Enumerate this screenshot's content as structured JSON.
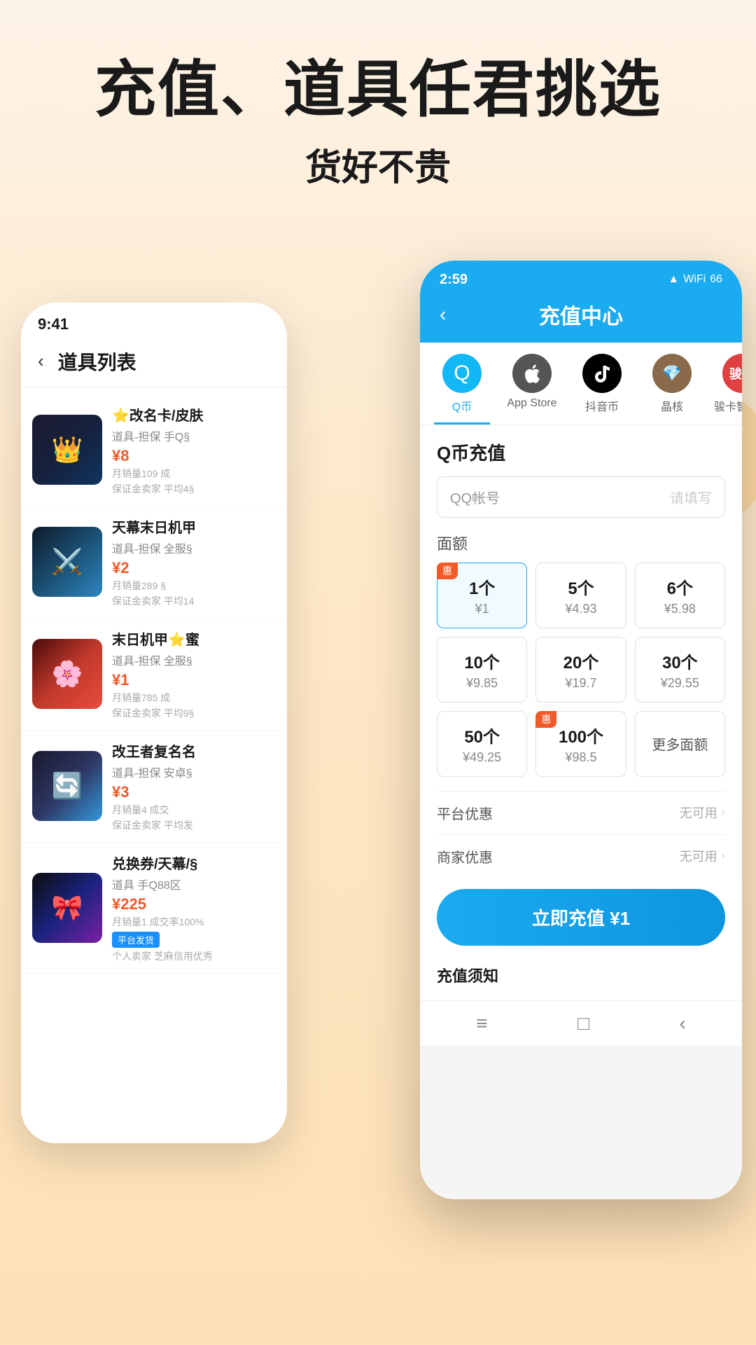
{
  "hero": {
    "title": "充值、道具任君挑选",
    "subtitle": "货好不贵"
  },
  "left_phone": {
    "status_time": "9:41",
    "header_title": "道具列表",
    "items": [
      {
        "name": "⭐改名卡/皮肤",
        "desc": "道具-担保 手Q§",
        "price": "¥8",
        "sales": "月销量109 成",
        "extra": "保证金卖家 平均4§",
        "bg": "bg1",
        "icon": "👑"
      },
      {
        "name": "天幕末日机甲",
        "desc": "道具-担保 全服§",
        "price": "¥2",
        "sales": "月销量289 §",
        "extra": "保证金卖家 平均14",
        "bg": "bg2",
        "icon": "⚔️"
      },
      {
        "name": "末日机甲⭐蜜",
        "desc": "道具-担保 全服§",
        "price": "¥1",
        "sales": "月销量785 成",
        "extra": "保证金卖家 平均9§",
        "bg": "bg3",
        "icon": "🌸"
      },
      {
        "name": "改王者复名名",
        "desc": "道具-担保 安卓§",
        "price": "¥3",
        "sales": "月销量4 成交",
        "extra": "保证金卖家 平均发",
        "bg": "bg4",
        "icon": "🔄"
      },
      {
        "name": "兑换券/天幕/§",
        "desc": "道具 手Q88区",
        "price": "¥225",
        "sales": "月销量1 成交率100%",
        "extra": "平台发货",
        "extra2": "个人卖家 芝麻信用优秀",
        "bg": "bg5",
        "icon": "🎀",
        "badge": "平台发货"
      }
    ]
  },
  "right_phone": {
    "status_time": "2:59",
    "status_icons": "▲ ▲ WiFi 66",
    "nav_title": "充值中心",
    "tabs": [
      {
        "id": "qq",
        "label": "Q币",
        "icon": "Q",
        "active": true
      },
      {
        "id": "appstore",
        "label": "App Store",
        "icon": "",
        "active": false
      },
      {
        "id": "tiktok",
        "label": "抖音币",
        "icon": "♪",
        "active": false
      },
      {
        "id": "crystal",
        "label": "晶核",
        "icon": "🎮",
        "active": false
      },
      {
        "id": "junka",
        "label": "骏卡智充卡",
        "icon": "JUNKA",
        "active": false
      }
    ],
    "section_title": "Q币充值",
    "input_label": "QQ帐号",
    "input_placeholder": "请填写",
    "denomination_title": "面额",
    "denominations": [
      {
        "count": "1个",
        "price": "¥1",
        "selected": true,
        "badge": "惠"
      },
      {
        "count": "5个",
        "price": "¥4.93",
        "selected": false,
        "badge": null
      },
      {
        "count": "6个",
        "price": "¥5.98",
        "selected": false,
        "badge": null
      },
      {
        "count": "10个",
        "price": "¥9.85",
        "selected": false,
        "badge": null
      },
      {
        "count": "20个",
        "price": "¥19.7",
        "selected": false,
        "badge": null
      },
      {
        "count": "30个",
        "price": "¥29.55",
        "selected": false,
        "badge": null
      },
      {
        "count": "50个",
        "price": "¥49.25",
        "selected": false,
        "badge": null
      },
      {
        "count": "100个",
        "price": "¥98.5",
        "selected": false,
        "badge": "惠"
      },
      {
        "count": "更多面额",
        "price": null,
        "selected": false,
        "badge": null,
        "more": true
      }
    ],
    "platform_discount": {
      "label": "平台优惠",
      "value": "无可用"
    },
    "merchant_discount": {
      "label": "商家优惠",
      "value": "无可用"
    },
    "recharge_btn": "立即充值 ¥1",
    "notice_title": "充值须知",
    "bottom_nav": [
      "≡",
      "□",
      "‹"
    ]
  }
}
